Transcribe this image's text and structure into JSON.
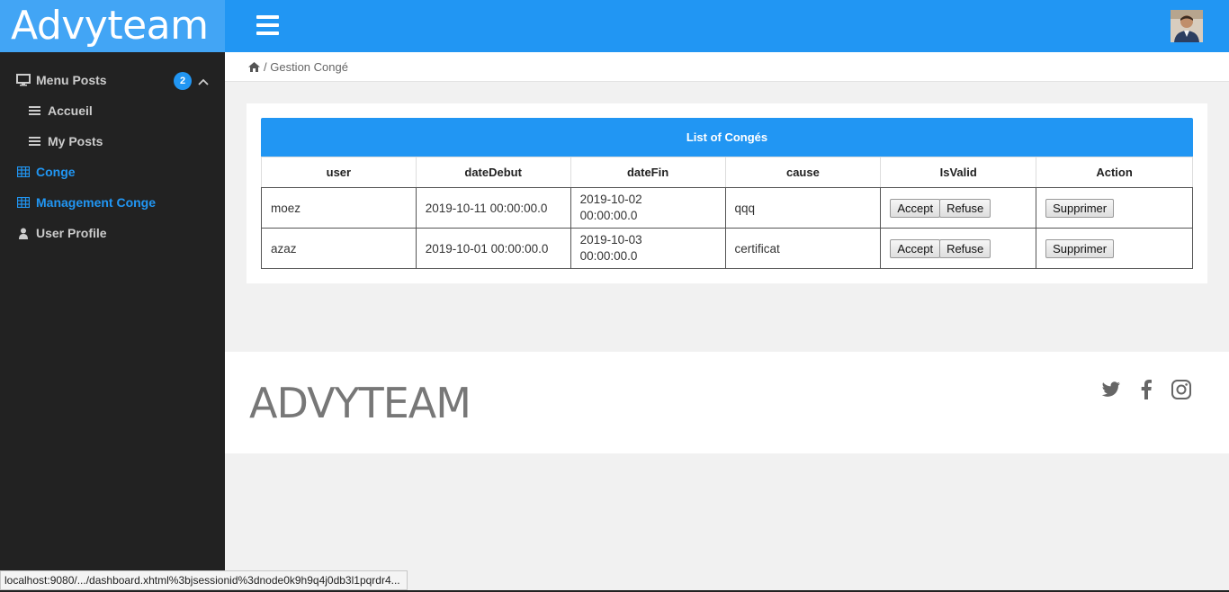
{
  "brand": "Advyteam",
  "sidebar": {
    "items": [
      {
        "label": "Menu Posts",
        "icon": "monitor-icon",
        "badge": "2"
      },
      {
        "label": "Accueil",
        "icon": "list-icon"
      },
      {
        "label": "My Posts",
        "icon": "list-icon"
      },
      {
        "label": "Conge",
        "icon": "table-icon"
      },
      {
        "label": "Management Conge",
        "icon": "table-icon"
      },
      {
        "label": "User Profile",
        "icon": "user-icon"
      }
    ]
  },
  "breadcrumb": {
    "page": "/ Gestion Congé"
  },
  "table": {
    "title": "List of Congés",
    "columns": [
      "user",
      "dateDebut",
      "dateFin",
      "cause",
      "IsValid",
      "Action"
    ],
    "rows": [
      {
        "user": "moez",
        "dateDebut": "2019-10-11 00:00:00.0",
        "dateFin": "2019-10-02 00:00:00.0",
        "cause": "qqq"
      },
      {
        "user": "azaz",
        "dateDebut": "2019-10-01 00:00:00.0",
        "dateFin": "2019-10-03 00:00:00.0",
        "cause": "certificat"
      }
    ],
    "accept_label": "Accept",
    "refuse_label": "Refuse",
    "delete_label": "Supprimer"
  },
  "footer": {
    "brand": "ADVYTEAM"
  },
  "statusbar": "localhost:9080/.../dashboard.xhtml%3bjsessionid%3dnode0k9h9q4j0db3l1pqrdr4...",
  "colors": {
    "primary": "#2196f3",
    "brand_bg": "#42a5f5",
    "sidebar_bg": "#222222"
  }
}
